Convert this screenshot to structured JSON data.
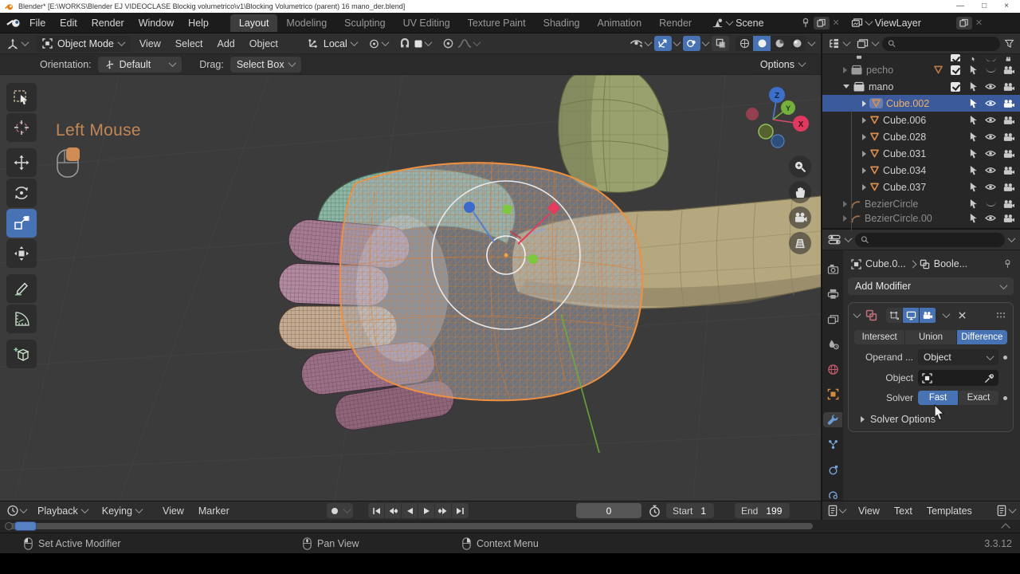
{
  "window": {
    "title": "Blender* [E:\\WORKS\\Blender EJ VIDEOCLASE Blockig volumetrico\\v1\\Blocking Volumetrico (parent) 16 mano_der.blend]",
    "controls": {
      "minimize": "—",
      "maximize": "□",
      "close": "×"
    }
  },
  "topbar": {
    "menus": [
      "File",
      "Edit",
      "Render",
      "Window",
      "Help"
    ],
    "tabs": [
      "Layout",
      "Modeling",
      "Sculpting",
      "UV Editing",
      "Texture Paint",
      "Shading",
      "Animation",
      "Render"
    ],
    "active_tab": "Layout",
    "scene": "Scene",
    "view_layer": "ViewLayer"
  },
  "viewport": {
    "header": {
      "mode": "Object Mode",
      "menus": [
        "View",
        "Select",
        "Add",
        "Object"
      ],
      "orientation": "Local"
    },
    "tool_settings": {
      "orientation_label": "Orientation:",
      "orientation_value": "Default",
      "drag_label": "Drag:",
      "drag_value": "Select Box",
      "options": "Options"
    },
    "overlay_hint": "Left Mouse",
    "axis_gizmo": {
      "x": "X",
      "y": "Y",
      "z": "Z"
    }
  },
  "outliner": {
    "rows": [
      {
        "name": "pecho",
        "type": "collection"
      },
      {
        "name": "mano",
        "type": "collection"
      },
      {
        "name": "Cube.002",
        "type": "mesh",
        "selected": true
      },
      {
        "name": "Cube.006",
        "type": "mesh"
      },
      {
        "name": "Cube.028",
        "type": "mesh"
      },
      {
        "name": "Cube.031",
        "type": "mesh"
      },
      {
        "name": "Cube.034",
        "type": "mesh"
      },
      {
        "name": "Cube.037",
        "type": "mesh"
      },
      {
        "name": "BezierCircle",
        "type": "curve"
      },
      {
        "name": "BezierCircle.00",
        "type": "curve"
      }
    ]
  },
  "properties": {
    "breadcrumb": {
      "object": "Cube.0...",
      "modifier": "Boole..."
    },
    "add_modifier": "Add Modifier",
    "modifier": {
      "operations": [
        "Intersect",
        "Union",
        "Difference"
      ],
      "active_operation": "Difference",
      "operand_label": "Operand ...",
      "operand_value": "Object",
      "object_label": "Object",
      "solver_label": "Solver",
      "solver_modes": [
        "Fast",
        "Exact"
      ],
      "active_solver": "Fast",
      "solver_options": "Solver Options"
    }
  },
  "timeline": {
    "menus": [
      "Playback",
      "Keying",
      "View",
      "Marker"
    ],
    "current_frame": "0",
    "start_label": "Start",
    "start_value": "1",
    "end_label": "End",
    "end_value": "199"
  },
  "text_editor": {
    "menus": [
      "View",
      "Text",
      "Templates"
    ]
  },
  "statusbar": {
    "hints": [
      "Set Active Modifier",
      "Pan View",
      "Context Menu"
    ],
    "version": "3.3.12"
  },
  "colors": {
    "accent_blue": "#4772b3",
    "selection_row": "#3b5a9b",
    "active_item_orange": "#f0b06a",
    "hint_orange": "#c08757",
    "mesh_icon_orange": "#d98d4e"
  }
}
